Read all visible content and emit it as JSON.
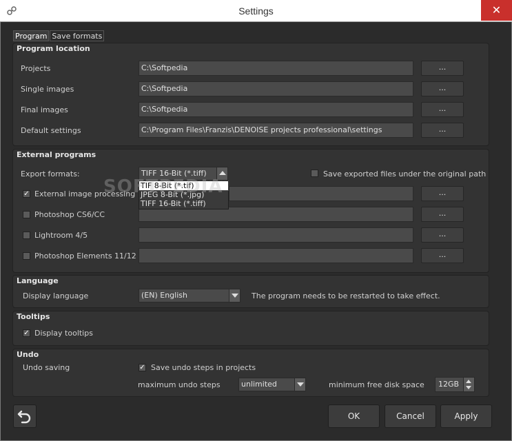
{
  "window": {
    "title": "Settings",
    "close_glyph": "✕"
  },
  "tabs": [
    "Program",
    "Save formats"
  ],
  "program_location": {
    "title": "Program location",
    "rows": [
      {
        "label": "Projects",
        "value": "C:\\Softpedia",
        "browse": "..."
      },
      {
        "label": "Single images",
        "value": "C:\\Softpedia",
        "browse": "..."
      },
      {
        "label": "Final images",
        "value": "C:\\Softpedia",
        "browse": "..."
      },
      {
        "label": "Default settings",
        "value": "C:\\Program Files\\Franzis\\DENOISE projects professional\\settings",
        "browse": "..."
      }
    ]
  },
  "external_programs": {
    "title": "External programs",
    "export_label": "Export formats:",
    "export_value": "TIFF 16-Bit (*.tiff)",
    "export_options": [
      "TIF 8-Bit (*.tif)",
      "JPEG 8-Bit (*.jpg)",
      "TIFF 16-Bit (*.tiff)"
    ],
    "save_original_label": "Save exported files under the original path",
    "save_original_checked": false,
    "rows": [
      {
        "label": "External image processing",
        "checked": true,
        "browse": "..."
      },
      {
        "label": "Photoshop CS6/CC",
        "checked": false,
        "browse": "..."
      },
      {
        "label": "Lightroom 4/5",
        "checked": false,
        "browse": "..."
      },
      {
        "label": "Photoshop Elements 11/12",
        "checked": false,
        "browse": "..."
      }
    ]
  },
  "language": {
    "title": "Language",
    "display_label": "Display language",
    "value": "(EN) English",
    "note": "The program needs to be restarted to take effect."
  },
  "tooltips": {
    "title": "Tooltips",
    "label": "Display tooltips",
    "checked": true
  },
  "undo": {
    "title": "Undo",
    "saving_label": "Undo saving",
    "save_steps_label": "Save undo steps in projects",
    "save_steps_checked": true,
    "max_steps_label": "maximum undo steps",
    "max_steps_value": "unlimited",
    "min_disk_label": "minimum free disk space",
    "min_disk_value": "12GB"
  },
  "buttons": {
    "ok": "OK",
    "cancel": "Cancel",
    "apply": "Apply"
  },
  "watermark": "SOFTPEDIA",
  "colors": {
    "panel": "#333333",
    "background": "#2b2b2b",
    "close": "#c9302c"
  }
}
